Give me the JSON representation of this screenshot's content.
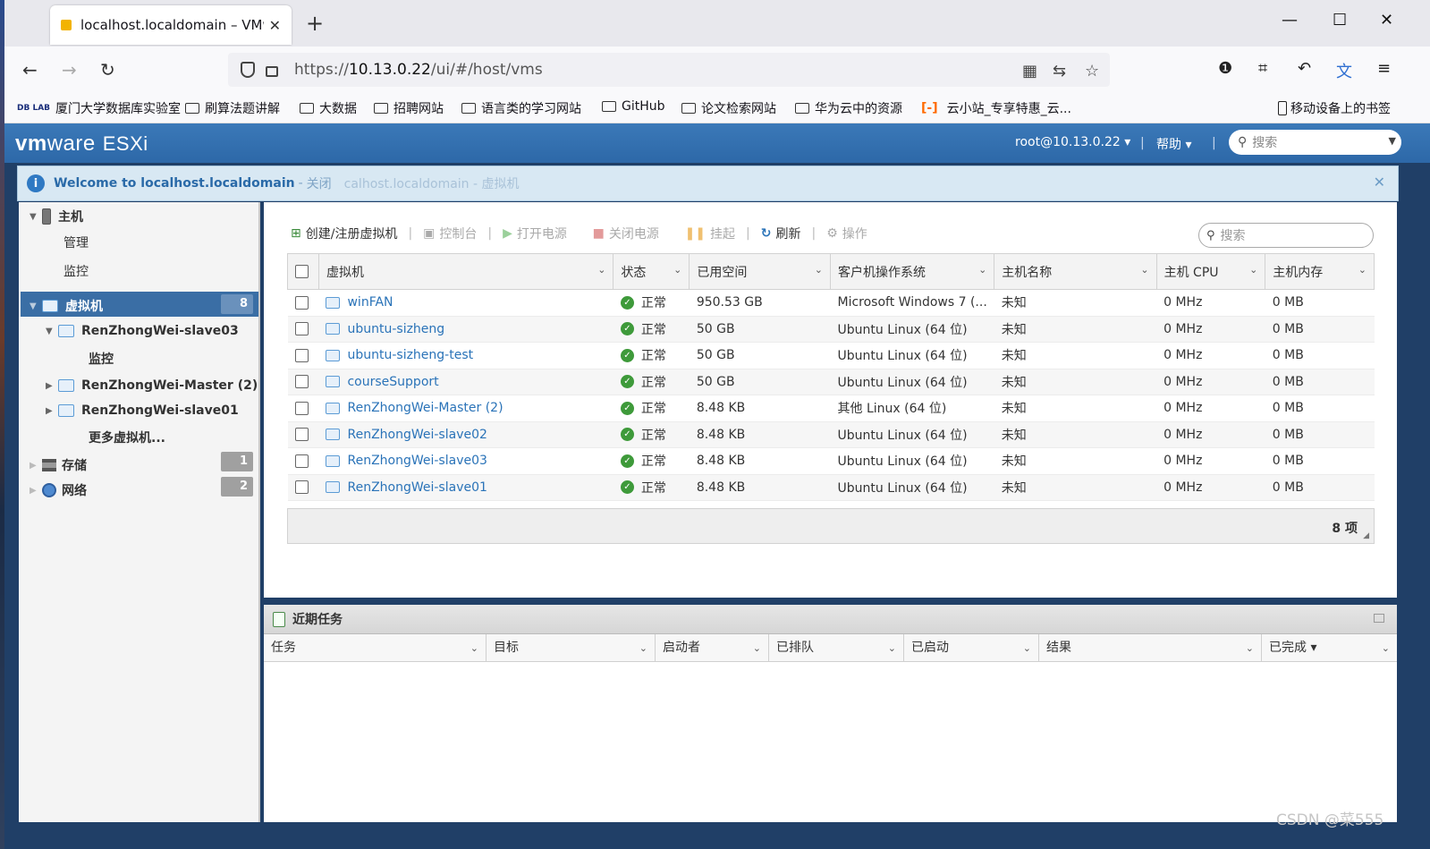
{
  "browser": {
    "tab_title": "localhost.localdomain – VMw",
    "url_prefix": "https://",
    "url_host": "10.13.0.22",
    "url_path": "/ui/#/host/vms",
    "bookmarks": [
      "厦门大学数据库实验室",
      "刷算法题讲解",
      "大数据",
      "招聘网站",
      "语言类的学习网站",
      "GitHub",
      "论文检索网站",
      "华为云中的资源",
      "云小站_专享特惠_云...",
      "移动设备上的书签"
    ],
    "bookmark_logo": "DB LAB"
  },
  "header": {
    "brand_vm": "vm",
    "brand_ware": "ware",
    "brand_product": "ESXi",
    "user": "root@10.13.0.22",
    "help": "帮助",
    "search_placeholder": "搜索"
  },
  "banner": {
    "message": "Welcome to localhost.localdomain",
    "close_label": "关闭",
    "ghost_text": "calhost.localdomain - 虚拟机"
  },
  "navigator": {
    "host_label": "主机",
    "host_manage": "管理",
    "host_monitor": "监控",
    "vms_label": "虚拟机",
    "vms_count": "8",
    "vm_items": [
      "RenZhongWei-slave03",
      "RenZhongWei-Master (2)",
      "RenZhongWei-slave01"
    ],
    "vm_sub_monitor": "监控",
    "more_vms": "更多虚拟机...",
    "storage_label": "存储",
    "storage_count": "1",
    "network_label": "网络",
    "network_count": "2"
  },
  "toolbar": {
    "create": "创建/注册虚拟机",
    "console": "控制台",
    "power_on": "打开电源",
    "power_off": "关闭电源",
    "suspend": "挂起",
    "refresh": "刷新",
    "actions": "操作",
    "search_placeholder": "搜索"
  },
  "grid": {
    "columns": [
      "虚拟机",
      "状态",
      "已用空间",
      "客户机操作系统",
      "主机名称",
      "主机 CPU",
      "主机内存"
    ],
    "rows": [
      {
        "name": "winFAN",
        "status": "正常",
        "space": "950.53 GB",
        "os": "Microsoft Windows 7 (...",
        "host": "未知",
        "cpu": "0 MHz",
        "mem": "0 MB"
      },
      {
        "name": "ubuntu-sizheng",
        "status": "正常",
        "space": "50 GB",
        "os": "Ubuntu Linux (64 位)",
        "host": "未知",
        "cpu": "0 MHz",
        "mem": "0 MB"
      },
      {
        "name": "ubuntu-sizheng-test",
        "status": "正常",
        "space": "50 GB",
        "os": "Ubuntu Linux (64 位)",
        "host": "未知",
        "cpu": "0 MHz",
        "mem": "0 MB"
      },
      {
        "name": "courseSupport",
        "status": "正常",
        "space": "50 GB",
        "os": "Ubuntu Linux (64 位)",
        "host": "未知",
        "cpu": "0 MHz",
        "mem": "0 MB"
      },
      {
        "name": "RenZhongWei-Master (2)",
        "status": "正常",
        "space": "8.48 KB",
        "os": "其他 Linux (64 位)",
        "host": "未知",
        "cpu": "0 MHz",
        "mem": "0 MB"
      },
      {
        "name": "RenZhongWei-slave02",
        "status": "正常",
        "space": "8.48 KB",
        "os": "Ubuntu Linux (64 位)",
        "host": "未知",
        "cpu": "0 MHz",
        "mem": "0 MB"
      },
      {
        "name": "RenZhongWei-slave03",
        "status": "正常",
        "space": "8.48 KB",
        "os": "Ubuntu Linux (64 位)",
        "host": "未知",
        "cpu": "0 MHz",
        "mem": "0 MB"
      },
      {
        "name": "RenZhongWei-slave01",
        "status": "正常",
        "space": "8.48 KB",
        "os": "Ubuntu Linux (64 位)",
        "host": "未知",
        "cpu": "0 MHz",
        "mem": "0 MB"
      }
    ],
    "item_count": "8 项"
  },
  "tasks": {
    "title": "近期任务",
    "columns": [
      "任务",
      "目标",
      "启动者",
      "已排队",
      "已启动",
      "结果",
      "已完成 ▾"
    ]
  },
  "watermark": "CSDN @菜555",
  "colors": {
    "esxi_header": "#3b79b8",
    "selected_nav": "#3a6ea5",
    "link": "#2a73b8",
    "ok": "#3e9a3a"
  }
}
